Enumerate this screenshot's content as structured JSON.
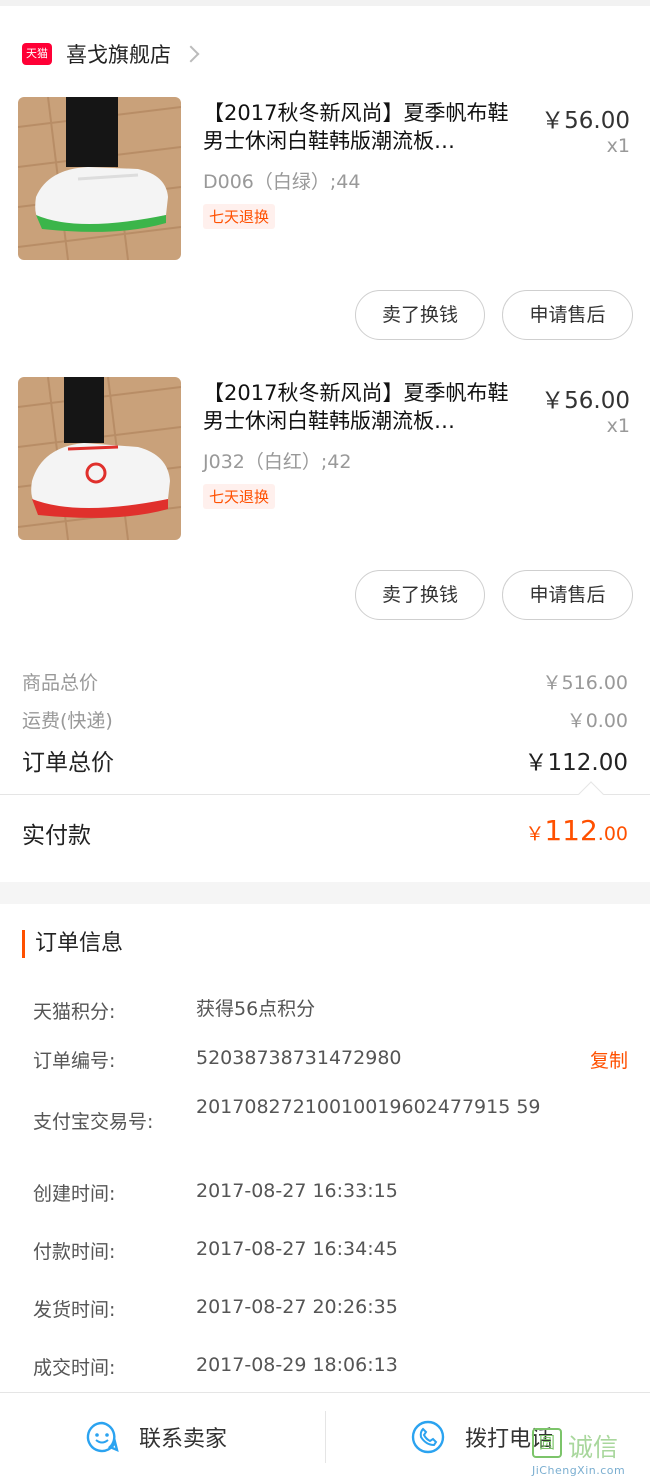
{
  "store": {
    "badge": "天猫",
    "name": "喜戈旗舰店"
  },
  "items": [
    {
      "title": "【2017秋冬新风尚】夏季帆布鞋男士休闲白鞋韩版潮流板…",
      "sku": "D006（白绿）;44",
      "tag": "七天退换",
      "price": "￥56.00",
      "qty": "x1",
      "sell_button": "卖了换钱",
      "after_sale_button": "申请售后",
      "accent_color": "#3bb54a"
    },
    {
      "title": "【2017秋冬新风尚】夏季帆布鞋男士休闲白鞋韩版潮流板…",
      "sku": "J032（白红）;42",
      "tag": "七天退换",
      "price": "￥56.00",
      "qty": "x1",
      "sell_button": "卖了换钱",
      "after_sale_button": "申请售后",
      "accent_color": "#e0302c"
    }
  ],
  "summary": {
    "goods_total_label": "商品总价",
    "goods_total_value": "￥516.00",
    "shipping_label": "运费(快递)",
    "shipping_value": "￥0.00",
    "order_total_label": "订单总价",
    "order_total_value": "￥112.00",
    "paid_label": "实付款",
    "paid_currency": "￥",
    "paid_int": "112",
    "paid_dec": ".00"
  },
  "order_info": {
    "title": "订单信息",
    "rows": [
      {
        "label": "天猫积分:",
        "value": "获得56点积分"
      },
      {
        "label": "订单编号:",
        "value": "52038738731472980"
      },
      {
        "label": "支付宝交易号:",
        "value": "20170827210010019602477915 59"
      },
      {
        "label": "创建时间:",
        "value": "2017-08-27 16:33:15"
      },
      {
        "label": "付款时间:",
        "value": "2017-08-27 16:34:45"
      },
      {
        "label": "发货时间:",
        "value": "2017-08-27 20:26:35"
      },
      {
        "label": "成交时间:",
        "value": "2017-08-29 18:06:13"
      }
    ],
    "copy_label": "复制"
  },
  "bottom_bar": {
    "contact_seller": "联系卖家",
    "call": "拨打电话"
  },
  "watermark": {
    "logo": "圆",
    "text": "诚信",
    "sub": "JiChengXin.com"
  },
  "colors": {
    "accent": "#ff5000",
    "tmall": "#ff0036",
    "icon_blue": "#2ba3f0"
  }
}
